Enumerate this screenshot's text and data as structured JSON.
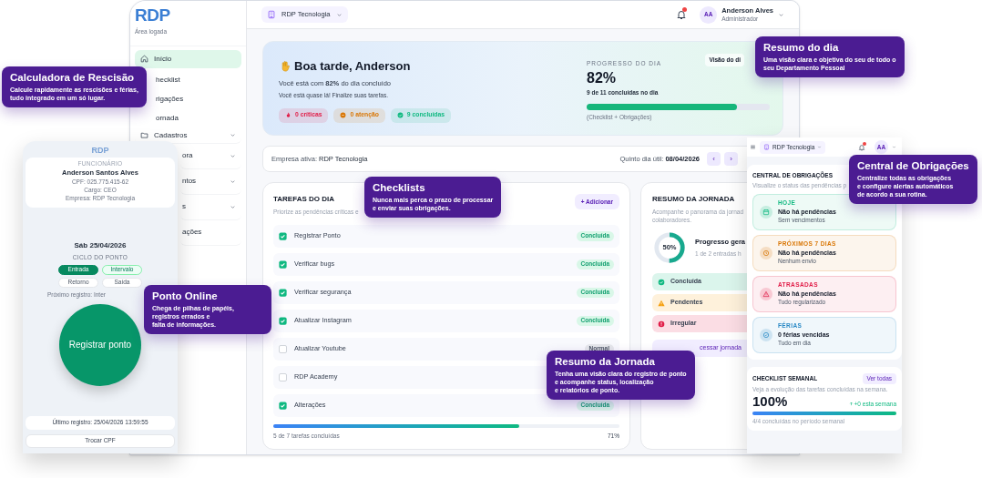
{
  "app": {
    "sidebar": {
      "logo": "RDP",
      "subtitle": "Área logada",
      "items": [
        {
          "label": "Início",
          "selected": true,
          "expandable": false
        },
        {
          "label": "hecklist",
          "selected": false,
          "expandable": false
        },
        {
          "label": "rigações",
          "selected": false,
          "expandable": false
        },
        {
          "label": "ornada",
          "selected": false,
          "expandable": false
        },
        {
          "label": "Cadastros",
          "selected": false,
          "expandable": true
        },
        {
          "label": "ora",
          "selected": false,
          "expandable": true
        },
        {
          "label": "ntos",
          "selected": false,
          "expandable": true
        },
        {
          "label": "s",
          "selected": false,
          "expandable": true
        },
        {
          "label": "ações",
          "selected": false,
          "expandable": false
        }
      ]
    },
    "header": {
      "company": "RDP Tecnologia",
      "notification": true,
      "avatar": "AA",
      "user_name": "Anderson Alves",
      "user_role": "Administrador"
    },
    "hero": {
      "greeting": "Boa tarde, Anderson",
      "summary": "Você está com **82%** do dia concluído",
      "message": "Você está quase lá! Finalize suas tarefas.",
      "badges": [
        {
          "label": "0 críticas",
          "color": "#e11d48"
        },
        {
          "label": "0 atenção",
          "color": "#d97706"
        },
        {
          "label": "9 concluídas",
          "color": "#10b981"
        }
      ],
      "progress": {
        "label": "PROGRESSO DO DIA",
        "value": "82%",
        "detail": "9 de 11 concluídas no dia",
        "level": 0.82,
        "note": "(Checklist + Obrigações)",
        "button": "Visão do di"
      }
    },
    "company_bar": {
      "label": "Empresa ativa:",
      "company": "RDP Tecnologia",
      "date_label": "Quinto dia útil:",
      "date": "08/04/2026",
      "prev": "‹",
      "next": "›"
    },
    "tasks": {
      "title": "TAREFAS DO DIA",
      "subtitle": "Priorize as pendências críticas e",
      "add_button": "+ Adicionar",
      "items": [
        {
          "label": "Registrar Ponto",
          "checked": true,
          "status": "Concluída",
          "kind": "done"
        },
        {
          "label": "Verificar bugs",
          "checked": true,
          "status": "Concluída",
          "kind": "done"
        },
        {
          "label": "Verificar segurança",
          "checked": true,
          "status": "Concluída",
          "kind": "done"
        },
        {
          "label": "Atualizar Instagram",
          "checked": true,
          "status": "Concluída",
          "kind": "done"
        },
        {
          "label": "Atualizar Youtube",
          "checked": false,
          "status": "Normal",
          "kind": "normal"
        },
        {
          "label": "RDP Academy",
          "checked": false
        },
        {
          "label": "Alterações",
          "checked": true,
          "status": "Concluída",
          "kind": "done"
        }
      ],
      "progress": {
        "level": 0.71,
        "caption": "5 de 7 tarefas concluídas",
        "value": "71%"
      }
    },
    "journey": {
      "title": "RESUMO DA JORNADA",
      "subtitle": "Acompanhe o panorama da jornad\ncolaboradores.",
      "donut": {
        "level": 0.5,
        "value": "50%"
      },
      "progress_title": "Progresso gera",
      "progress_detail": "1 de 2 entradas h",
      "statuses": [
        {
          "label": "Concluída",
          "color": "#10b981"
        },
        {
          "label": "Pendentes",
          "color": "#f59e0b"
        },
        {
          "label": "Irregular",
          "color": "#e11d48"
        }
      ],
      "button": "cessar jornada"
    }
  },
  "time_clock": {
    "logo": "RDP",
    "employee_label": "FUNCIONÁRIO",
    "employee_name": "Anderson Santos Alves",
    "cpf": "CPF: 025.775.415-62",
    "role": "Cargo: CEO",
    "company": "Empresa: RDP Tecnologia",
    "date": "Sáb 25/04/2026",
    "cycle_label": "CICLO DO PONTO",
    "steps": [
      {
        "label": "Entrada",
        "done": true,
        "current": false
      },
      {
        "label": "Intervalo",
        "done": false,
        "current": true
      },
      {
        "label": "Retorno",
        "done": false,
        "current": false
      },
      {
        "label": "Saída",
        "done": false,
        "current": false
      }
    ],
    "next_record": "Próximo registro: Inter",
    "register_button": "Registrar ponto",
    "last_record": "Último registro: 25/04/2026 13:59:55",
    "switch_button": "Trocar CPF"
  },
  "obligations": {
    "header": {
      "company": "RDP Tecnologia",
      "notification": true,
      "avatar": "AA"
    },
    "title": "CENTRAL DE OBRIGAÇÕES",
    "subtitle": "Visualize o status das pendências p",
    "items": [
      {
        "period": "HOJE",
        "title": "Não há pendências",
        "detail": "Sem vencimentos",
        "color": "#10b981"
      },
      {
        "period": "PRÓXIMOS 7 DIAS",
        "title": "Não há pendências",
        "detail": "Nenhum envio",
        "color": "#d97706"
      },
      {
        "period": "ATRASADAS",
        "title": "Não há pendências",
        "detail": "Tudo regularizado",
        "color": "#e11d48"
      },
      {
        "period": "FÉRIAS",
        "title": "0 férias vencidas",
        "detail": "Tudo em dia",
        "color": "#2b8ac6"
      }
    ],
    "weekly": {
      "title": "CHECKLIST SEMANAL",
      "button": "Ver todas",
      "subtitle": "Veja a evolução das tarefas concluídas na semana.",
      "value": "100%",
      "trend": "+0 esta semana",
      "level": 1,
      "caption": "4/4 concluídas no período semanal"
    }
  },
  "callouts": [
    {
      "title": "Calculadora de Rescisão",
      "text": "Calcule rapidamente as rescisões e férias,\ntudo integrado em um só lugar."
    },
    {
      "title": "Resumo do dia",
      "text": "Uma visão clara e objetiva do seu de todo o\nseu Departamento Pessoal"
    },
    {
      "title": "Checklists",
      "text": "Nunca mais perca o prazo de processar\ne enviar suas obrigações."
    },
    {
      "title": "Central de Obrigações",
      "text": "Centralize todas as obrigações\ne configure alertas automáticos\nde acordo a sua rotina."
    },
    {
      "title": "Ponto Online",
      "text": "Chega de pilhas de papéis,\nregistros errados e\nfalta de informações."
    },
    {
      "title": "Resumo da Jornada",
      "text": "Tenha uma visão clara do registro de ponto\ne acompanhe status, localização\ne relatórios de ponto."
    }
  ]
}
